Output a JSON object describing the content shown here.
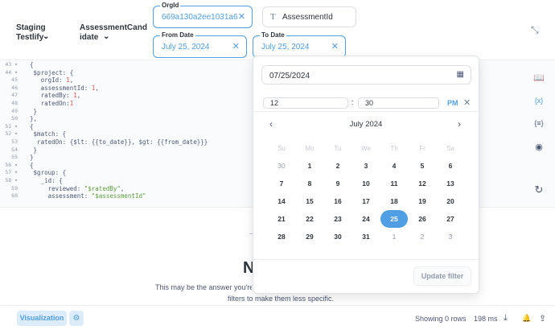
{
  "header": {
    "breadcrumb_1": "Staging Testlify",
    "breadcrumb_2_line1": "AssessmentCand",
    "breadcrumb_2_line2": "idate",
    "filters": {
      "orgid": {
        "label": "OrgId",
        "value": "669a130a2ee1031a65ca"
      },
      "assessment": {
        "value": "AssessmentId"
      },
      "from_date": {
        "label": "From Date",
        "value": "July 25, 2024"
      },
      "to_date": {
        "label": "To Date",
        "value": "July 25, 2024"
      }
    },
    "close_glyph": "✕",
    "chevron_glyph": "⌄",
    "text_glyph": "T",
    "collapse_glyph": "⤡"
  },
  "editor": {
    "line_numbers": [
      "43 ▾",
      "44 ▾",
      "45",
      "46",
      "47",
      "48",
      "49",
      "50",
      "51 ▾",
      "52 ▾",
      "53",
      "54",
      "55",
      "56 ▾",
      "57 ▾",
      "58 ▾",
      "59",
      "60"
    ],
    "lines": [
      {
        "segs": [
          {
            "t": "  {"
          }
        ]
      },
      {
        "segs": [
          {
            "t": "   $project: {"
          }
        ]
      },
      {
        "segs": [
          {
            "t": "     orgId: "
          },
          {
            "t": "1",
            "c": "num"
          },
          {
            "t": ","
          }
        ]
      },
      {
        "segs": [
          {
            "t": "     assessmentId: "
          },
          {
            "t": "1",
            "c": "num"
          },
          {
            "t": ","
          }
        ]
      },
      {
        "segs": [
          {
            "t": "     ratedBy: "
          },
          {
            "t": "1",
            "c": "num"
          },
          {
            "t": ","
          }
        ]
      },
      {
        "segs": [
          {
            "t": "     ratedOn:"
          },
          {
            "t": "1",
            "c": "num"
          }
        ]
      },
      {
        "segs": [
          {
            "t": "   }"
          }
        ]
      },
      {
        "segs": [
          {
            "t": "  },"
          }
        ]
      },
      {
        "segs": [
          {
            "t": "  {"
          }
        ]
      },
      {
        "segs": [
          {
            "t": "   $match: {"
          }
        ]
      },
      {
        "segs": [
          {
            "t": "    ratedOn: {$lt: {{to_date}}, $gt: {{from_date}}}"
          }
        ]
      },
      {
        "segs": [
          {
            "t": "   }"
          }
        ]
      },
      {
        "segs": [
          {
            "t": "  }"
          }
        ]
      },
      {
        "segs": [
          {
            "t": "  {"
          }
        ]
      },
      {
        "segs": [
          {
            "t": "   $group: {"
          }
        ]
      },
      {
        "segs": [
          {
            "t": "     _id: {"
          }
        ]
      },
      {
        "segs": [
          {
            "t": "       reviewed: "
          },
          {
            "t": "\"$ratedBy\"",
            "c": "str"
          },
          {
            "t": ","
          }
        ]
      },
      {
        "segs": [
          {
            "t": "       assessment: "
          },
          {
            "t": "\"$assessmentId\"",
            "c": "str"
          }
        ]
      }
    ]
  },
  "side_icons": {
    "book": "📖",
    "variables": "{x}",
    "snippets": "{≡}",
    "preview": "◉",
    "refresh": "↻"
  },
  "empty_state": {
    "title": "N",
    "line1": "This may be the answer you're l",
    "line2": "filters to make them less specific."
  },
  "footer": {
    "visualization": "Visualization",
    "gear_glyph": "⚙",
    "rows": "Showing 0 rows",
    "duration": "198 ms",
    "download_glyph": "⤓",
    "alert_glyph": "🔔",
    "share_glyph": "⇪"
  },
  "picker": {
    "date_value": "07/25/2024",
    "calendar_glyph": "▦",
    "hour": "12",
    "minute": "30",
    "colon": ":",
    "ampm": "PM",
    "clear_glyph": "✕",
    "prev_glyph": "‹",
    "next_glyph": "›",
    "month": "July 2024",
    "weekdays": [
      "Su",
      "Mo",
      "Tu",
      "We",
      "Th",
      "Fr",
      "Sa"
    ],
    "weeks": [
      [
        "30",
        "1",
        "2",
        "3",
        "4",
        "5",
        "6"
      ],
      [
        "7",
        "8",
        "9",
        "10",
        "11",
        "12",
        "13"
      ],
      [
        "14",
        "15",
        "16",
        "17",
        "18",
        "19",
        "20"
      ],
      [
        "21",
        "22",
        "23",
        "24",
        "25",
        "26",
        "27"
      ],
      [
        "28",
        "29",
        "30",
        "31",
        "1",
        "2",
        "3"
      ]
    ],
    "selected_day": "25",
    "update_button": "Update filter"
  }
}
